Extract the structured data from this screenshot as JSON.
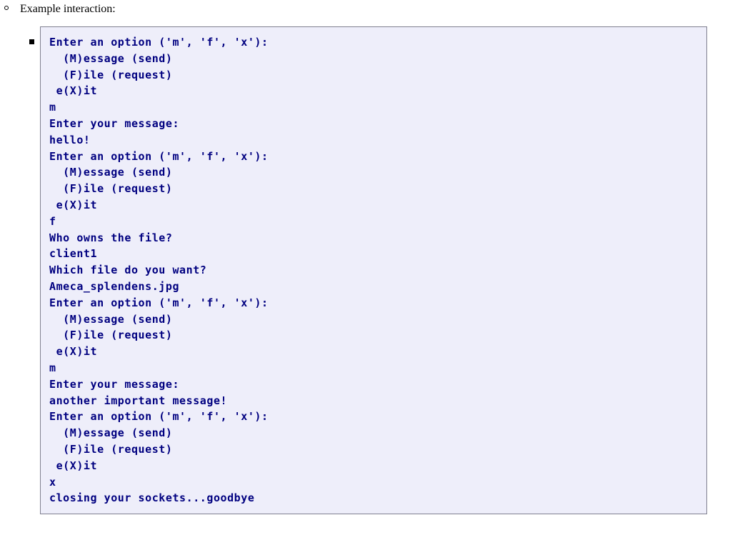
{
  "page": {
    "bullet_icon": "hollow-circle-bullet",
    "sub_bullet_icon": "filled-square-bullet",
    "heading": "Example interaction:"
  },
  "colors": {
    "code_background": "#eeeefa",
    "code_border": "#808090",
    "code_text": "#000080",
    "page_background": "#ffffff",
    "body_text": "#000000"
  },
  "terminal": {
    "lines": [
      "Enter an option ('m', 'f', 'x'):",
      "  (M)essage (send)",
      "  (F)ile (request)",
      " e(X)it",
      "m",
      "Enter your message:",
      "hello!",
      "Enter an option ('m', 'f', 'x'):",
      "  (M)essage (send)",
      "  (F)ile (request)",
      " e(X)it",
      "f",
      "Who owns the file?",
      "client1",
      "Which file do you want?",
      "Ameca_splendens.jpg",
      "Enter an option ('m', 'f', 'x'):",
      "  (M)essage (send)",
      "  (F)ile (request)",
      " e(X)it",
      "m",
      "Enter your message:",
      "another important message!",
      "Enter an option ('m', 'f', 'x'):",
      "  (M)essage (send)",
      "  (F)ile (request)",
      " e(X)it",
      "x",
      "closing your sockets...goodbye"
    ]
  }
}
